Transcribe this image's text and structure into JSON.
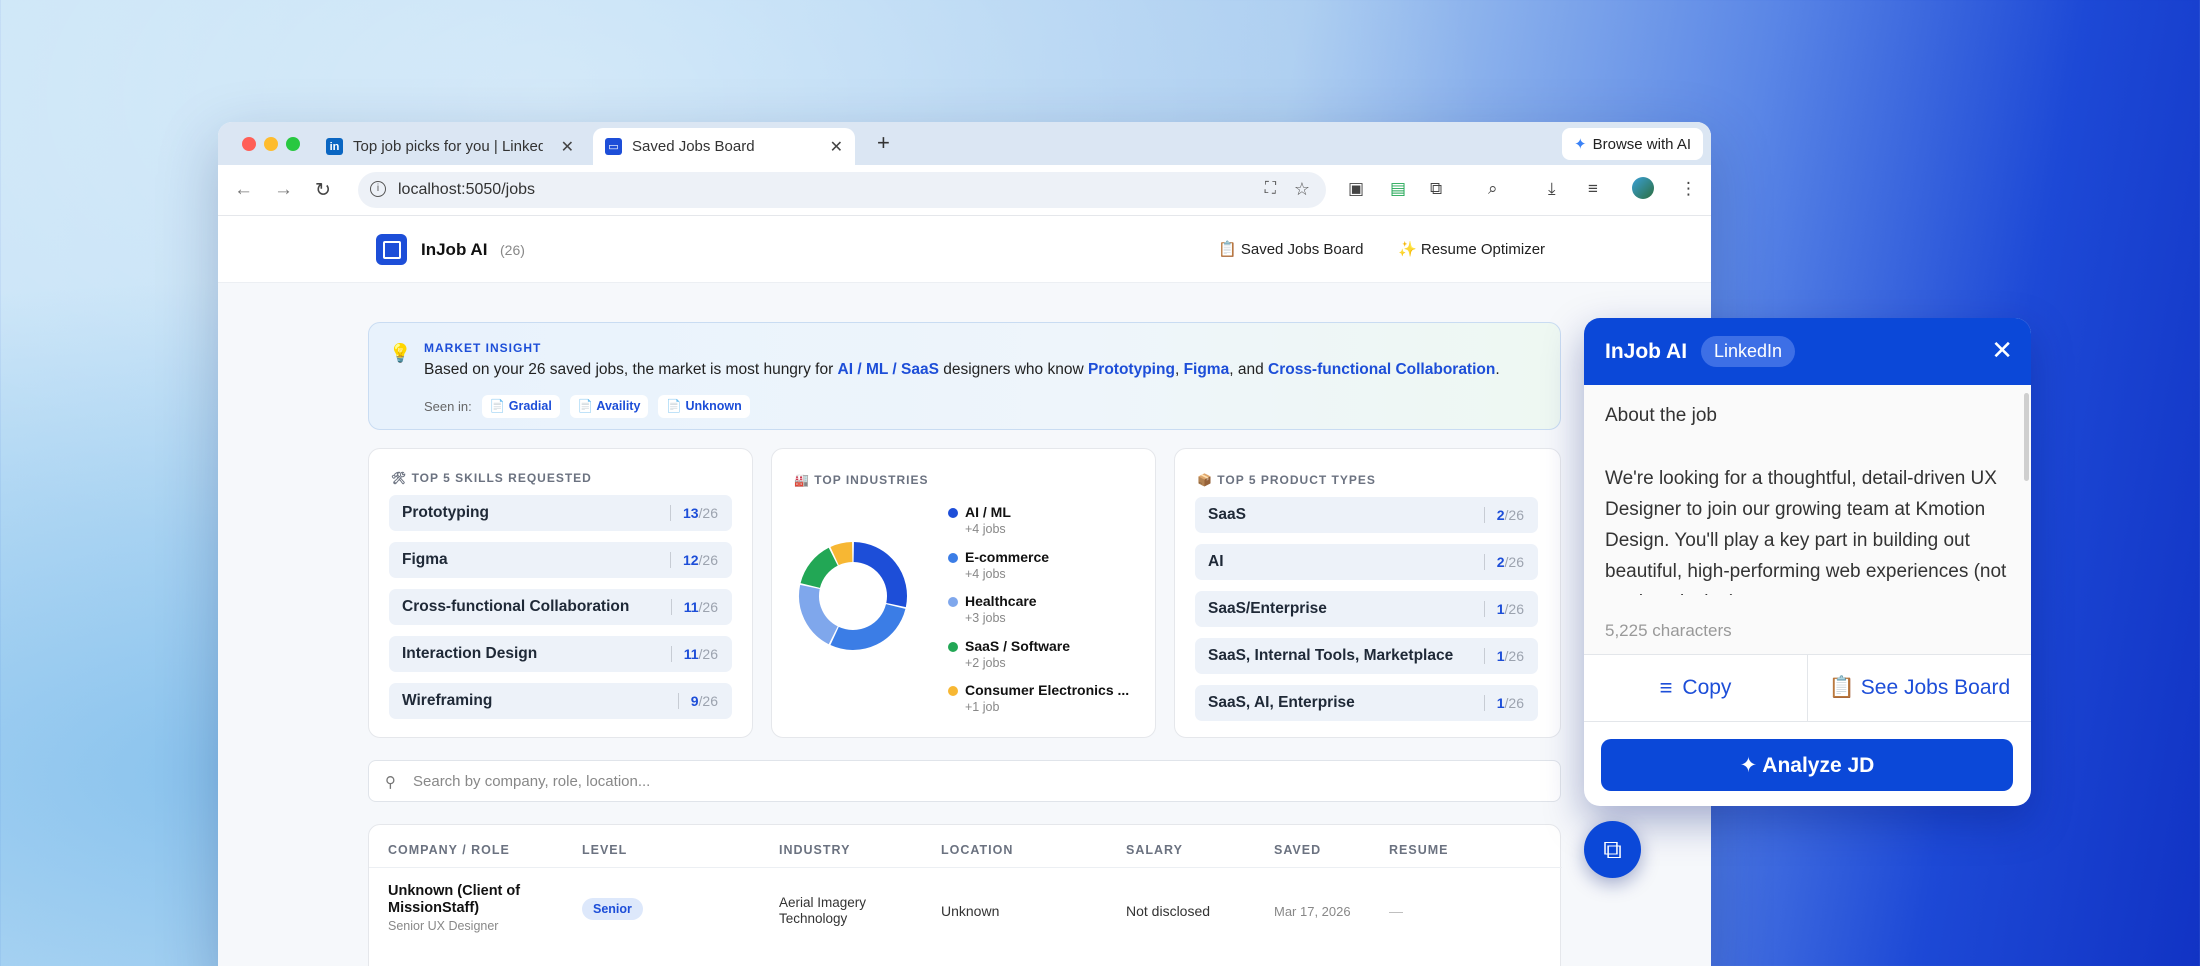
{
  "browser": {
    "tabs": [
      {
        "label": "Top job picks for you | LinkedIn",
        "favicon": "linkedin-icon"
      },
      {
        "label": "Saved Jobs Board",
        "favicon": "app-icon"
      }
    ],
    "new_tab": "+",
    "browse_ai_label": "Browse with AI",
    "url": "localhost:5050/jobs"
  },
  "app": {
    "brand": "InJob AI",
    "count": "(26)",
    "nav": [
      {
        "icon": "📋",
        "label": "Saved Jobs Board"
      },
      {
        "icon": "✨",
        "label": "Resume Optimizer"
      }
    ]
  },
  "insight": {
    "kicker": "MARKET INSIGHT",
    "text_1": "Based on your 26 saved jobs, the market is most hungry for ",
    "industry": "AI / ML / SaaS",
    "text_2": " designers who know ",
    "skill_1": "Prototyping",
    "sep_1": ", ",
    "skill_2": "Figma",
    "sep_2": ", and ",
    "skill_3": "Cross-functional Collaboration",
    "end": ".",
    "seen_label": "Seen in:",
    "seen_chips": [
      "Gradial",
      "Availity",
      "Unknown"
    ]
  },
  "skills": {
    "title": "🛠 TOP 5 SKILLS REQUESTED",
    "total": "/26",
    "rows": [
      {
        "label": "Prototyping",
        "count": "13"
      },
      {
        "label": "Figma",
        "count": "12"
      },
      {
        "label": "Cross-functional Collaboration",
        "count": "11"
      },
      {
        "label": "Interaction Design",
        "count": "11"
      },
      {
        "label": "Wireframing",
        "count": "9"
      }
    ]
  },
  "industries": {
    "title": "🏭 TOP INDUSTRIES",
    "items": [
      {
        "label": "AI / ML",
        "sub": "+4 jobs",
        "color": "#1d4ed8",
        "value": 4
      },
      {
        "label": "E-commerce",
        "sub": "+4 jobs",
        "color": "#3b7de6",
        "value": 4
      },
      {
        "label": "Healthcare",
        "sub": "+3 jobs",
        "color": "#7fa7ec",
        "value": 3
      },
      {
        "label": "SaaS / Software",
        "sub": "+2 jobs",
        "color": "#22a755",
        "value": 2
      },
      {
        "label": "Consumer Electronics ...",
        "sub": "+1 job",
        "color": "#f7b733",
        "value": 1
      }
    ]
  },
  "products": {
    "title": "📦 TOP 5 PRODUCT TYPES",
    "total": "/26",
    "rows": [
      {
        "label": "SaaS",
        "count": "2"
      },
      {
        "label": "AI",
        "count": "2"
      },
      {
        "label": "SaaS/Enterprise",
        "count": "1"
      },
      {
        "label": "SaaS, Internal Tools, Marketplace",
        "count": "1"
      },
      {
        "label": "SaaS, AI, Enterprise",
        "count": "1"
      }
    ]
  },
  "search": {
    "placeholder": "Search by company, role, location..."
  },
  "table": {
    "headers": [
      "COMPANY / ROLE",
      "LEVEL",
      "INDUSTRY",
      "LOCATION",
      "SALARY",
      "SAVED",
      "RESUME"
    ],
    "rows": [
      {
        "company": "Unknown (Client of MissionStaff)",
        "role": "Senior UX Designer",
        "level": "Senior",
        "industry": "Aerial Imagery Technology",
        "location": "Unknown",
        "salary": "Not disclosed",
        "saved": "Mar 17, 2026",
        "resume": "—"
      }
    ]
  },
  "panel": {
    "title": "InJob AI",
    "source": "LinkedIn",
    "heading": "About the job",
    "body": "We're looking for a thoughtful, detail-driven UX Designer to join our growing team at Kmotion Design. You'll play a key part in building out beautiful, high-performing web experiences (not product design).",
    "chars": "5,225 characters",
    "copy_label": "Copy",
    "board_label": "📋 See Jobs Board",
    "analyze_label": "✦ Analyze JD"
  }
}
